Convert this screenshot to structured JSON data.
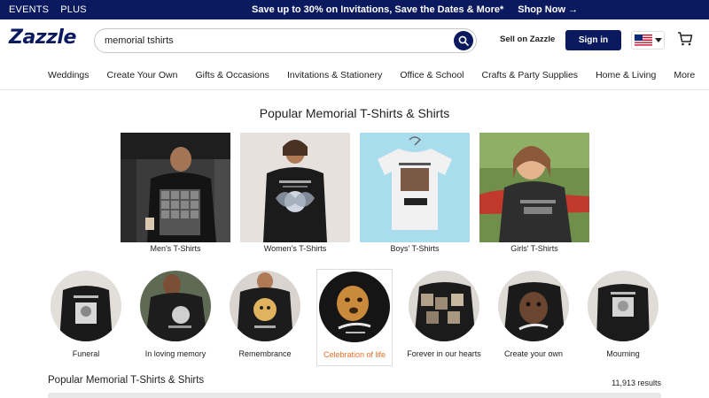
{
  "promo": {
    "links": [
      "EVENTS",
      "PLUS"
    ],
    "message": "Save up to 30% on Invitations, Save the Dates & More*",
    "cta": "Shop Now →"
  },
  "header": {
    "logo": "Zazzle",
    "search_value": "memorial tshirts",
    "sell": "Sell on Zazzle",
    "signin": "Sign in"
  },
  "nav": [
    "Weddings",
    "Create Your Own",
    "Gifts & Occasions",
    "Invitations & Stationery",
    "Office & School",
    "Crafts & Party Supplies",
    "Home & Living",
    "More"
  ],
  "main": {
    "title": "Popular Memorial T-Shirts & Shirts",
    "cards": [
      {
        "label": "Men's T-Shirts"
      },
      {
        "label": "Women's T-Shirts"
      },
      {
        "label": "Boys' T-Shirts"
      },
      {
        "label": "Girls' T-Shirts"
      }
    ],
    "chips": [
      {
        "label": "Funeral"
      },
      {
        "label": "In loving memory"
      },
      {
        "label": "Remembrance"
      },
      {
        "label": "Celebration of life",
        "selected": true
      },
      {
        "label": "Forever in our hearts"
      },
      {
        "label": "Create your own"
      },
      {
        "label": "Mourning"
      }
    ],
    "results_title": "Popular Memorial T-Shirts & Shirts",
    "results_count": "11,913 results"
  },
  "colors": {
    "brand": "#0b1a5e",
    "accent": "#e8702a"
  },
  "icons": [
    "search-icon",
    "us-flag-icon",
    "chevron-down-icon",
    "cart-icon"
  ]
}
